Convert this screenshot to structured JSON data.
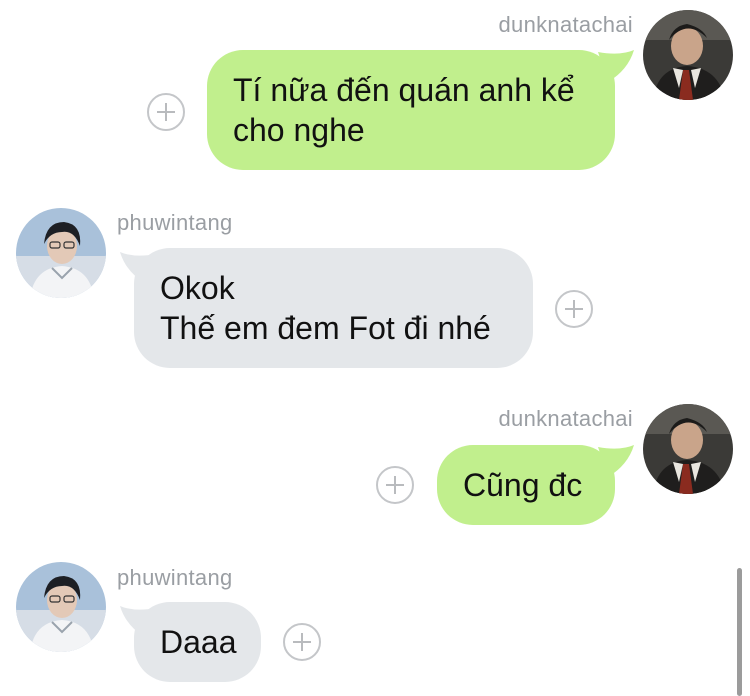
{
  "messages": [
    {
      "direction": "sent",
      "username": "dunknatachai",
      "lines": [
        "Tí nữa đến quán anh kể",
        "cho nghe"
      ]
    },
    {
      "direction": "received",
      "username": "phuwintang",
      "lines": [
        "Okok",
        "Thế em đem Fot đi nhé"
      ]
    },
    {
      "direction": "sent",
      "username": "dunknatachai",
      "lines": [
        "Cũng đc"
      ]
    },
    {
      "direction": "received",
      "username": "phuwintang",
      "lines": [
        "Daaa"
      ]
    }
  ],
  "colors": {
    "sent_bubble": "#c1ef8d",
    "received_bubble": "#e4e7ea",
    "username_text": "#9a9ea3"
  },
  "icons": {
    "add_reaction": "plus-circle-icon"
  }
}
